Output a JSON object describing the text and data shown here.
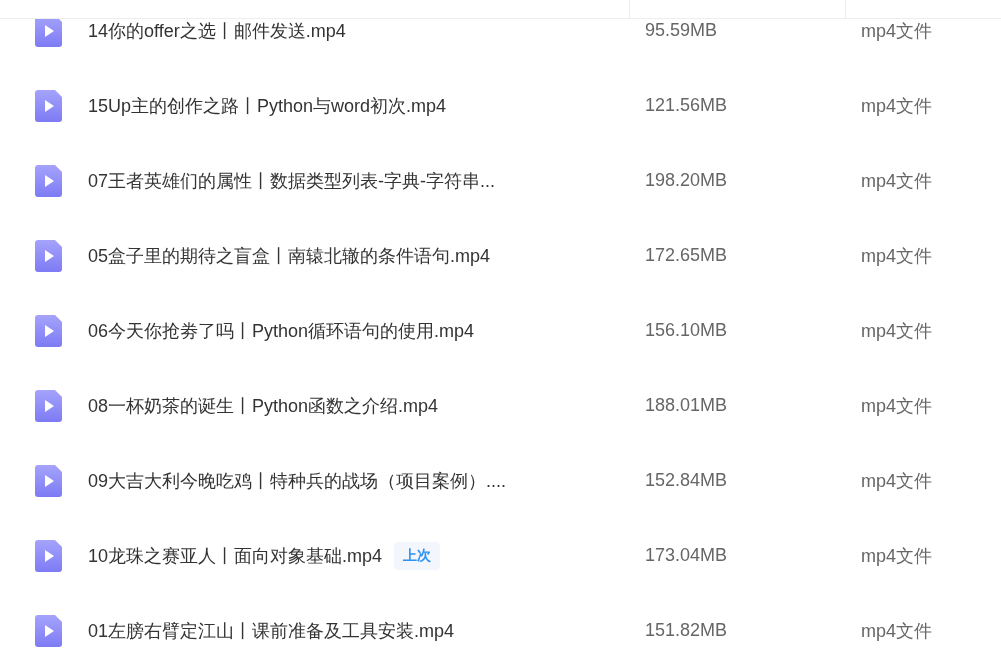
{
  "files": [
    {
      "name": "14你的offer之选丨邮件发送.mp4",
      "size": "95.59MB",
      "type": "mp4文件"
    },
    {
      "name": "15Up主的创作之路丨Python与word初次.mp4",
      "size": "121.56MB",
      "type": "mp4文件"
    },
    {
      "name": "07王者英雄们的属性丨数据类型列表-字典-字符串...",
      "size": "198.20MB",
      "type": "mp4文件"
    },
    {
      "name": "05盒子里的期待之盲盒丨南辕北辙的条件语句.mp4",
      "size": "172.65MB",
      "type": "mp4文件"
    },
    {
      "name": "06今天你抢劵了吗丨Python循环语句的使用.mp4",
      "size": "156.10MB",
      "type": "mp4文件"
    },
    {
      "name": "08一杯奶茶的诞生丨Python函数之介绍.mp4",
      "size": "188.01MB",
      "type": "mp4文件"
    },
    {
      "name": "09大吉大利今晚吃鸡丨特种兵的战场（项目案例）....",
      "size": "152.84MB",
      "type": "mp4文件"
    },
    {
      "name": "10龙珠之赛亚人丨面向对象基础.mp4",
      "size": "173.04MB",
      "type": "mp4文件",
      "tag": "上次"
    },
    {
      "name": "01左膀右臂定江山丨课前准备及工具安装.mp4",
      "size": "151.82MB",
      "type": "mp4文件"
    }
  ]
}
